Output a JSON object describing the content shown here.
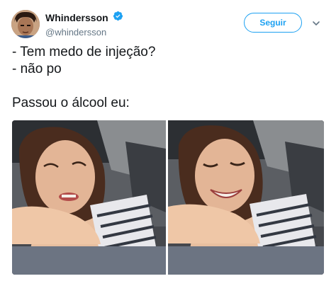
{
  "author": {
    "display_name": "Whindersson",
    "handle": "@whindersson",
    "verified": true,
    "avatar_icon": "profile-avatar"
  },
  "actions": {
    "follow_label": "Seguir",
    "more_icon": "chevron-down-icon"
  },
  "tweet": {
    "lines": [
      "- Tem medo de injeção?",
      "- não po",
      "Passou o álcool eu:"
    ]
  },
  "media": {
    "images": [
      {
        "name": "meme-photo-left",
        "description_icon": "photo"
      },
      {
        "name": "meme-photo-right",
        "description_icon": "photo"
      }
    ]
  },
  "colors": {
    "accent": "#1da1f2",
    "text": "#14171a",
    "muted": "#657786"
  }
}
